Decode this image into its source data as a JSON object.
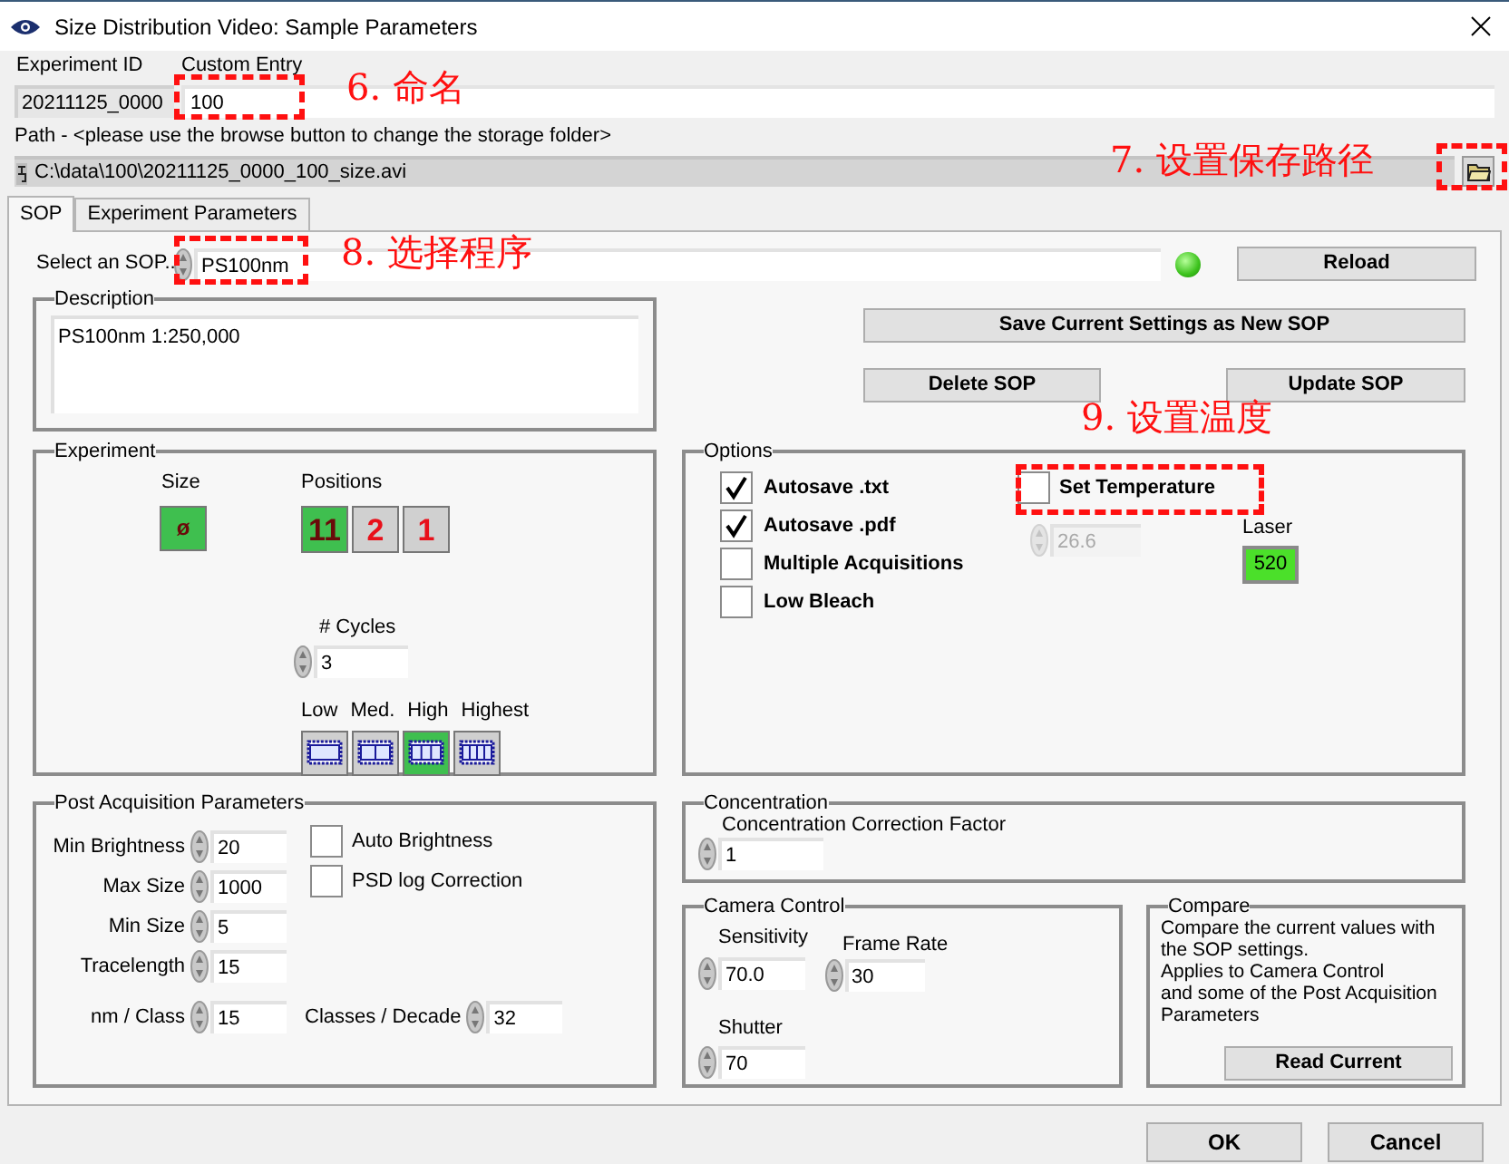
{
  "window": {
    "title": "Size Distribution Video: Sample Parameters"
  },
  "experiment_id": {
    "label": "Experiment ID",
    "value": "20211125_0000"
  },
  "custom_entry": {
    "label": "Custom Entry",
    "value": "100"
  },
  "path": {
    "label": "Path - <please use the browse button to change the storage folder>",
    "value": "C:\\data\\100\\20211125_0000_100_size.avi"
  },
  "tabs": [
    {
      "label": "SOP",
      "selected": true
    },
    {
      "label": "Experiment Parameters",
      "selected": false
    }
  ],
  "sop": {
    "label": "Select an SOP..",
    "value": "PS100nm",
    "led_on": true,
    "reload": "Reload"
  },
  "description": {
    "title": "Description",
    "text": "PS100nm 1:250,000"
  },
  "sop_buttons": {
    "save": "Save Current Settings as New SOP",
    "delete": "Delete SOP",
    "update": "Update SOP"
  },
  "experiment": {
    "title": "Experiment",
    "size": {
      "label": "Size",
      "symbol": "ø",
      "selected": true
    },
    "positions": {
      "label": "Positions",
      "items": [
        {
          "label": "11",
          "selected": true
        },
        {
          "label": "2",
          "selected": false
        },
        {
          "label": "1",
          "selected": false
        }
      ]
    },
    "cycles": {
      "label": "# Cycles",
      "value": "3"
    },
    "quality": [
      {
        "label": "Low",
        "selected": false
      },
      {
        "label": "Med.",
        "selected": false
      },
      {
        "label": "High",
        "selected": true
      },
      {
        "label": "Highest",
        "selected": false
      }
    ]
  },
  "options": {
    "title": "Options",
    "checkboxes": [
      {
        "label": "Autosave .txt",
        "checked": true
      },
      {
        "label": "Autosave .pdf",
        "checked": true
      },
      {
        "label": "Multiple Acquisitions",
        "checked": false
      },
      {
        "label": "Low Bleach",
        "checked": false
      }
    ],
    "temperature": {
      "label": "Set Temperature",
      "checked": false,
      "value": "26.6"
    },
    "laser": {
      "label": "Laser",
      "value": "520"
    }
  },
  "post_acquisition": {
    "title": "Post Acquisition Parameters",
    "fields": [
      {
        "label": "Min Brightness",
        "value": "20"
      },
      {
        "label": "Max Size",
        "value": "1000"
      },
      {
        "label": "Min Size",
        "value": "5"
      },
      {
        "label": "Tracelength",
        "value": "15"
      },
      {
        "label": "nm / Class",
        "value": "15"
      }
    ],
    "side_field": {
      "label": "Classes / Decade",
      "value": "32"
    },
    "checkboxes": [
      {
        "label": "Auto Brightness",
        "checked": false
      },
      {
        "label": "PSD log Correction",
        "checked": false
      }
    ]
  },
  "concentration": {
    "title": "Concentration",
    "label": "Concentration Correction Factor",
    "value": "1"
  },
  "camera_control": {
    "title": "Camera Control",
    "sensitivity": {
      "label": "Sensitivity",
      "value": "70.0"
    },
    "frame_rate": {
      "label": "Frame Rate",
      "value": "30"
    },
    "shutter": {
      "label": "Shutter",
      "value": "70"
    }
  },
  "compare": {
    "title": "Compare",
    "text": "Compare the current values with the SOP settings.\nApplies to Camera Control\nand some of the Post Acquisition Parameters",
    "button": "Read Current"
  },
  "buttons": {
    "ok": "OK",
    "cancel": "Cancel"
  },
  "annotations": [
    {
      "label": "6. 命名"
    },
    {
      "label": "7. 设置保存路径"
    },
    {
      "label": "8. 选择程序"
    },
    {
      "label": "9. 设置温度"
    }
  ]
}
